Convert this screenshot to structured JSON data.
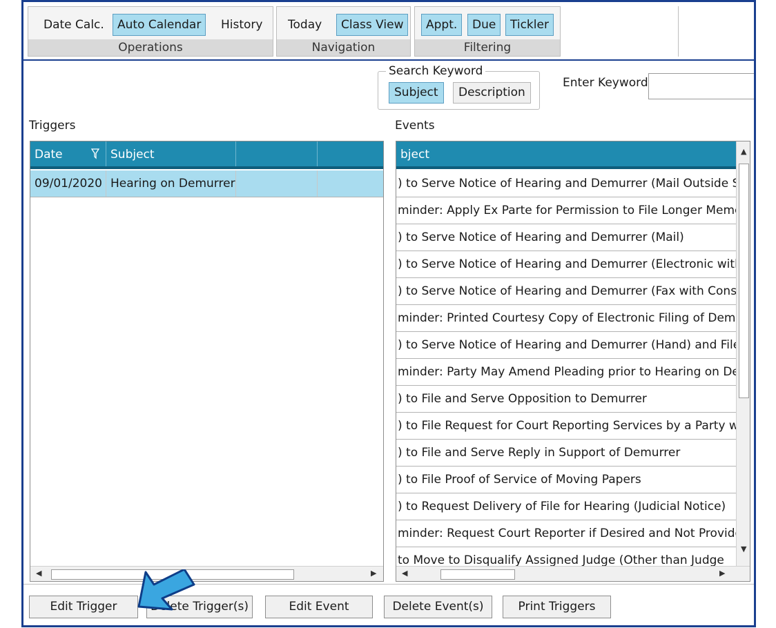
{
  "ribbon": {
    "groups": [
      {
        "label": "Operations",
        "buttons": [
          {
            "label": "Date Calc.",
            "active": false
          },
          {
            "label": "Auto Calendar",
            "active": true
          },
          {
            "label": "History",
            "active": false
          }
        ]
      },
      {
        "label": "Navigation",
        "buttons": [
          {
            "label": "Today",
            "active": false
          },
          {
            "label": "Class View",
            "active": true
          }
        ]
      },
      {
        "label": "Filtering",
        "buttons": [
          {
            "label": "Appt.",
            "active": true
          },
          {
            "label": "Due",
            "active": true
          },
          {
            "label": "Tickler",
            "active": true
          }
        ]
      }
    ]
  },
  "search": {
    "legend": "Search Keyword",
    "subject_label": "Subject",
    "description_label": "Description",
    "keyword_label": "Enter Keyword",
    "keyword_value": ""
  },
  "triggers": {
    "title": "Triggers",
    "columns": [
      "Date",
      "Subject",
      "",
      ""
    ],
    "rows": [
      {
        "date": "09/01/2020",
        "subject": "Hearing on Demurrer"
      }
    ]
  },
  "events": {
    "title": "Events",
    "column": "bject",
    "rows": [
      ") to Serve Notice of Hearing and Demurrer (Mail Outside S",
      "minder: Apply Ex Parte for Permission to File Longer Memc",
      ") to Serve Notice of Hearing and Demurrer (Mail)",
      ") to Serve Notice of Hearing and Demurrer (Electronic with",
      ") to Serve Notice of Hearing and Demurrer (Fax with Conse",
      "minder: Printed Courtesy Copy of Electronic Filing of Demu",
      ") to Serve Notice of Hearing and Demurrer (Hand) and File",
      "minder: Party May Amend Pleading prior to Hearing on De",
      ") to File and Serve Opposition to Demurrer",
      ") to File Request for Court Reporting Services by a Party wi",
      ") to File and Serve Reply in Support of Demurrer",
      ") to File Proof of Service of Moving Papers",
      ") to Request Delivery of File for Hearing (Judicial Notice)",
      "minder: Request Court Reporter if Desired and Not Provide",
      "to Move to Disqualify Assigned Judge (Other than Judge"
    ]
  },
  "buttons": {
    "edit_trigger": "Edit Trigger",
    "delete_triggers": "Delete Trigger(s)",
    "edit_event": "Edit Event",
    "delete_events": "Delete Event(s)",
    "print_triggers": "Print Triggers"
  },
  "colors": {
    "header": "#1f8bb0",
    "selected": "#a9dcef",
    "frame": "#1a3f8f",
    "annotation_arrow": "#3aa6e0"
  }
}
